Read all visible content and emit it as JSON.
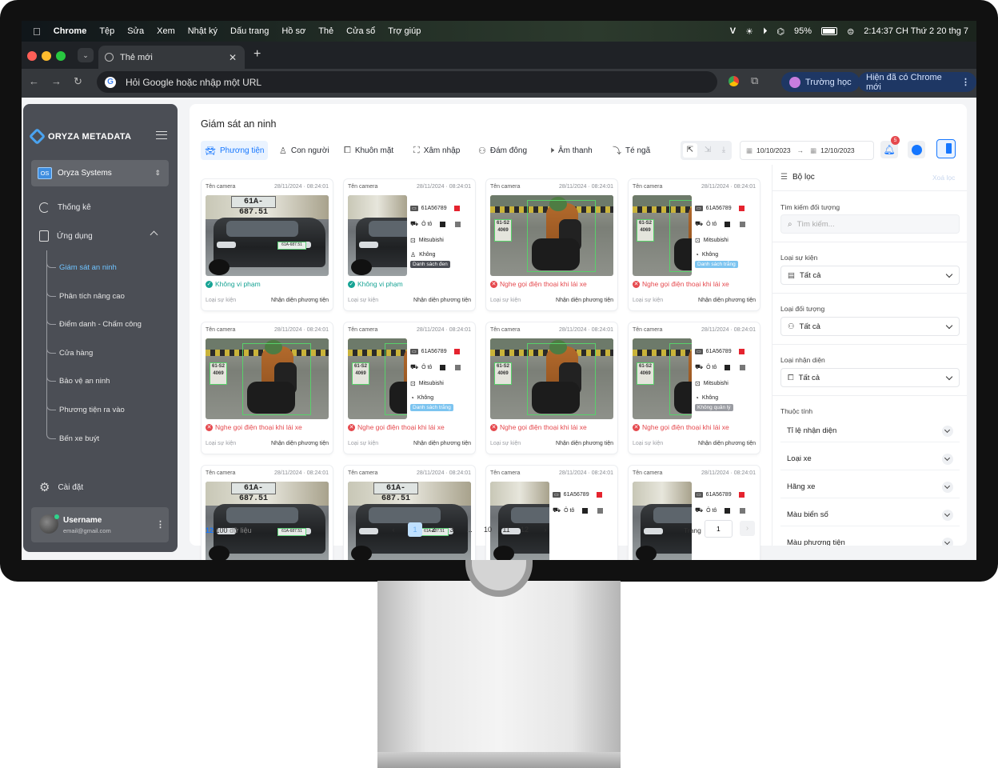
{
  "menubar": {
    "app": "Chrome",
    "items": [
      "Tệp",
      "Sửa",
      "Xem",
      "Nhật ký",
      "Dấu trang",
      "Hồ sơ",
      "Thẻ",
      "Cửa sổ",
      "Trợ giúp"
    ],
    "battery": "95%",
    "clock": "2:14:37 CH Thứ 2 20 thg 7"
  },
  "browser": {
    "tab_title": "Thẻ mới",
    "omnibox_placeholder": "Hỏi Google hoặc nhập một URL",
    "profile_chip": "Trường học",
    "update_chip": "Hiện đã có Chrome mới"
  },
  "sidebar": {
    "logo": "ORYZA METADATA",
    "org": "Oryza Systems",
    "org_badge": "OS",
    "items": [
      {
        "label": "Thống kê",
        "icon": "chart-pie-icon"
      },
      {
        "label": "Ứng dụng",
        "icon": "clipboard-icon"
      }
    ],
    "sub_items": [
      "Giám sát an ninh",
      "Phân tích nâng cao",
      "Điểm danh - Chấm công",
      "Cửa hàng",
      "Bảo vệ an ninh",
      "Phương tiện ra vào",
      "Bến xe buýt"
    ],
    "settings": "Cài đặt",
    "user": {
      "name": "Username",
      "email": "email@gmail.com"
    }
  },
  "main": {
    "title": "Giám sát an ninh",
    "tabs": [
      {
        "label": "Phương tiện",
        "icon": "car-icon"
      },
      {
        "label": "Con người",
        "icon": "user-icon"
      },
      {
        "label": "Khuôn mặt",
        "icon": "face-scan-icon"
      },
      {
        "label": "Xâm nhập",
        "icon": "intrusion-icon"
      },
      {
        "label": "Đám đông",
        "icon": "crowd-icon"
      },
      {
        "label": "Âm thanh",
        "icon": "speaker-icon"
      },
      {
        "label": "Té ngã",
        "icon": "fall-icon"
      }
    ],
    "date_from": "10/10/2023",
    "date_to": "12/10/2023",
    "notif_count": "5"
  },
  "card_common": {
    "camera_label": "Tên camera",
    "time": "28/11/2024 · 08:24:01",
    "event_label": "Loại sự kiện",
    "event_value": "Nhận diện phương tiện"
  },
  "cards": [
    {
      "kind": "car",
      "status": "Không vi phạm",
      "ok": true
    },
    {
      "kind": "car-info",
      "status": "Không vi phạm",
      "ok": true,
      "plate": "61A56789",
      "type": "Ô tô",
      "brand": "Mitsubishi",
      "extra": "Không",
      "list": "Danh sách đen",
      "list_color": "#4b4e55"
    },
    {
      "kind": "moto",
      "status": "Nghe gọi điện thoại khi lái xe",
      "ok": false
    },
    {
      "kind": "moto-info",
      "status": "Nghe gọi điện thoại khi lái xe",
      "ok": false,
      "plate": "61A56789",
      "type": "Ô tô",
      "brand": "Mitsubishi",
      "extra": "Không",
      "list": "Danh sách trắng",
      "list_color": "#7cc4f0"
    },
    {
      "kind": "moto",
      "status": "Nghe gọi điện thoại khi lái xe",
      "ok": false
    },
    {
      "kind": "moto-info",
      "status": "Nghe gọi điện thoại khi lái xe",
      "ok": false,
      "plate": "61A56789",
      "type": "Ô tô",
      "brand": "Mitsubishi",
      "extra": "Không",
      "list": "Danh sách trắng",
      "list_color": "#7cc4f0"
    },
    {
      "kind": "moto",
      "status": "Nghe gọi điện thoại khi lái xe",
      "ok": false
    },
    {
      "kind": "moto-info",
      "status": "Nghe gọi điện thoại khi lái xe",
      "ok": false,
      "plate": "61A56789",
      "type": "Ô tô",
      "brand": "Mitsubishi",
      "extra": "Không",
      "list": "Không quản lý",
      "list_color": "#9a9ca2"
    },
    {
      "kind": "car",
      "status": "",
      "ok": true
    },
    {
      "kind": "car",
      "status": "",
      "ok": true
    },
    {
      "kind": "car-info",
      "status": "",
      "ok": true,
      "plate": "61A56789",
      "type": "Ô tô"
    },
    {
      "kind": "car-info",
      "status": "",
      "ok": true,
      "plate": "61A56789",
      "type": "Ô tô"
    }
  ],
  "plate_text": "61A-687.51",
  "moto_plate": "61-S2 4069",
  "pagination": {
    "shown": "12",
    "total": "/100",
    "suffix": "dữ liệu",
    "pages": [
      "1",
      "2",
      "3",
      "...",
      "10",
      "11",
      "12"
    ],
    "page_label": "Trang",
    "page_input": "1"
  },
  "filter": {
    "title": "Bộ lọc",
    "clear": "Xoá lọc",
    "search_label": "Tìm kiếm đối tượng",
    "search_placeholder": "Tìm kiếm...",
    "event_type_label": "Loại sự kiện",
    "object_type_label": "Loại đối tượng",
    "recog_type_label": "Loại nhận diện",
    "all": "Tất cả",
    "attr_label": "Thuộc tính",
    "attrs": [
      "Tỉ lệ nhận diện",
      "Loại xe",
      "Hãng xe",
      "Màu biển số",
      "Màu phương tiện"
    ]
  },
  "colors": {
    "accent": "#1677ff",
    "ok": "#16a394",
    "bad": "#e5484d",
    "sidebar": "#4b4e55"
  }
}
